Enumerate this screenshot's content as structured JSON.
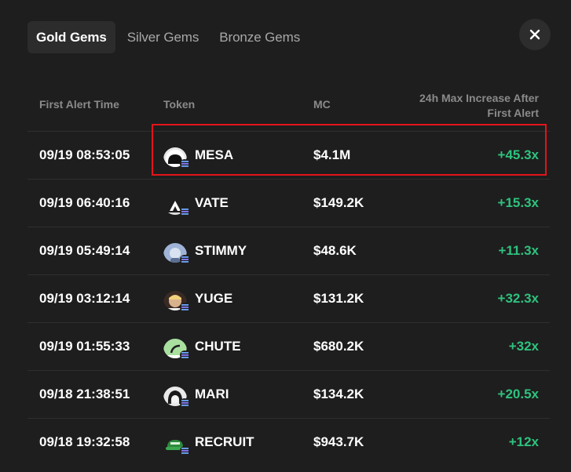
{
  "tabs": [
    {
      "label": "Gold Gems",
      "active": true
    },
    {
      "label": "Silver Gems",
      "active": false
    },
    {
      "label": "Bronze Gems",
      "active": false
    }
  ],
  "close_icon": "close-icon",
  "table": {
    "headers": {
      "first_alert_time": "First Alert Time",
      "token": "Token",
      "mc": "MC",
      "increase_line1": "24h Max Increase After",
      "increase_line2": "First Alert"
    },
    "rows": [
      {
        "time": "09/19 08:53:05",
        "token": "MESA",
        "mc": "$4.1M",
        "increase": "+45.3x",
        "icon": "mesa-token-icon"
      },
      {
        "time": "09/19 06:40:16",
        "token": "VATE",
        "mc": "$149.2K",
        "increase": "+15.3x",
        "icon": "vate-token-icon"
      },
      {
        "time": "09/19 05:49:14",
        "token": "STIMMY",
        "mc": "$48.6K",
        "increase": "+11.3x",
        "icon": "stimmy-token-icon"
      },
      {
        "time": "09/19 03:12:14",
        "token": "YUGE",
        "mc": "$131.2K",
        "increase": "+32.3x",
        "icon": "yuge-token-icon"
      },
      {
        "time": "09/19 01:55:33",
        "token": "CHUTE",
        "mc": "$680.2K",
        "increase": "+32x",
        "icon": "chute-token-icon"
      },
      {
        "time": "09/18 21:38:51",
        "token": "MARI",
        "mc": "$134.2K",
        "increase": "+20.5x",
        "icon": "mari-token-icon"
      },
      {
        "time": "09/18 19:32:58",
        "token": "RECRUIT",
        "mc": "$943.7K",
        "increase": "+12x",
        "icon": "recruit-token-icon"
      }
    ]
  },
  "colors": {
    "background": "#1e1e1e",
    "increase_green": "#2ec27e",
    "highlight_red": "#e3141b"
  }
}
